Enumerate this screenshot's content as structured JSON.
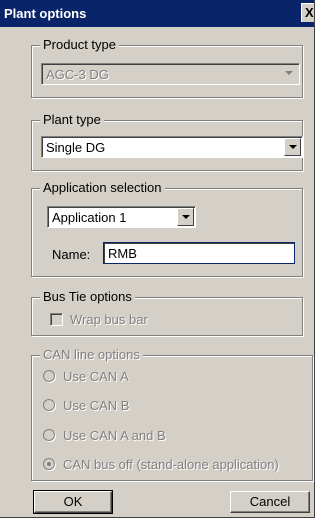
{
  "window": {
    "title": "Plant options",
    "close_glyph": "X"
  },
  "product_type": {
    "legend": "Product type",
    "value": "AGC-3 DG"
  },
  "plant_type": {
    "legend": "Plant type",
    "value": "Single DG"
  },
  "application_selection": {
    "legend": "Application selection",
    "application_value": "Application 1",
    "name_label": "Name:",
    "name_value": "RMB"
  },
  "bus_tie": {
    "legend": "Bus Tie options",
    "wrap_label": "Wrap bus bar",
    "wrap_checked": false
  },
  "can_line": {
    "legend": "CAN line options",
    "options": [
      {
        "label": "Use CAN A",
        "checked": false
      },
      {
        "label": "Use CAN B",
        "checked": false
      },
      {
        "label": "Use CAN A and B",
        "checked": false
      },
      {
        "label": "CAN bus off (stand-alone application)",
        "checked": true
      }
    ]
  },
  "buttons": {
    "ok": "OK",
    "cancel": "Cancel"
  }
}
